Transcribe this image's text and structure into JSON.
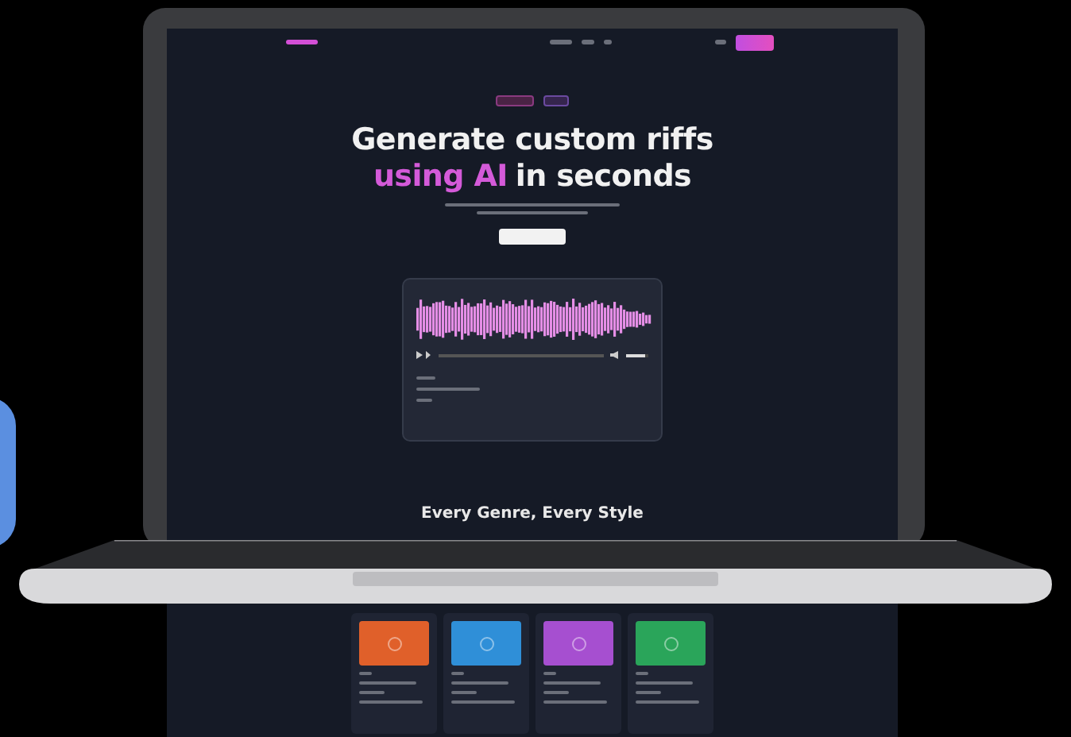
{
  "hero": {
    "title": "Generate custom riffs",
    "title_highlight": "using AI",
    "title_rest": "in seconds"
  },
  "player": {
    "volume": {
      "level": 0.85
    }
  },
  "section_heading": "Every Genre, Every Style",
  "cards": [
    {
      "color": "#e0602a"
    },
    {
      "color": "#2f8fd8"
    },
    {
      "color": "#a64fd0"
    },
    {
      "color": "#2aa55a"
    }
  ]
}
